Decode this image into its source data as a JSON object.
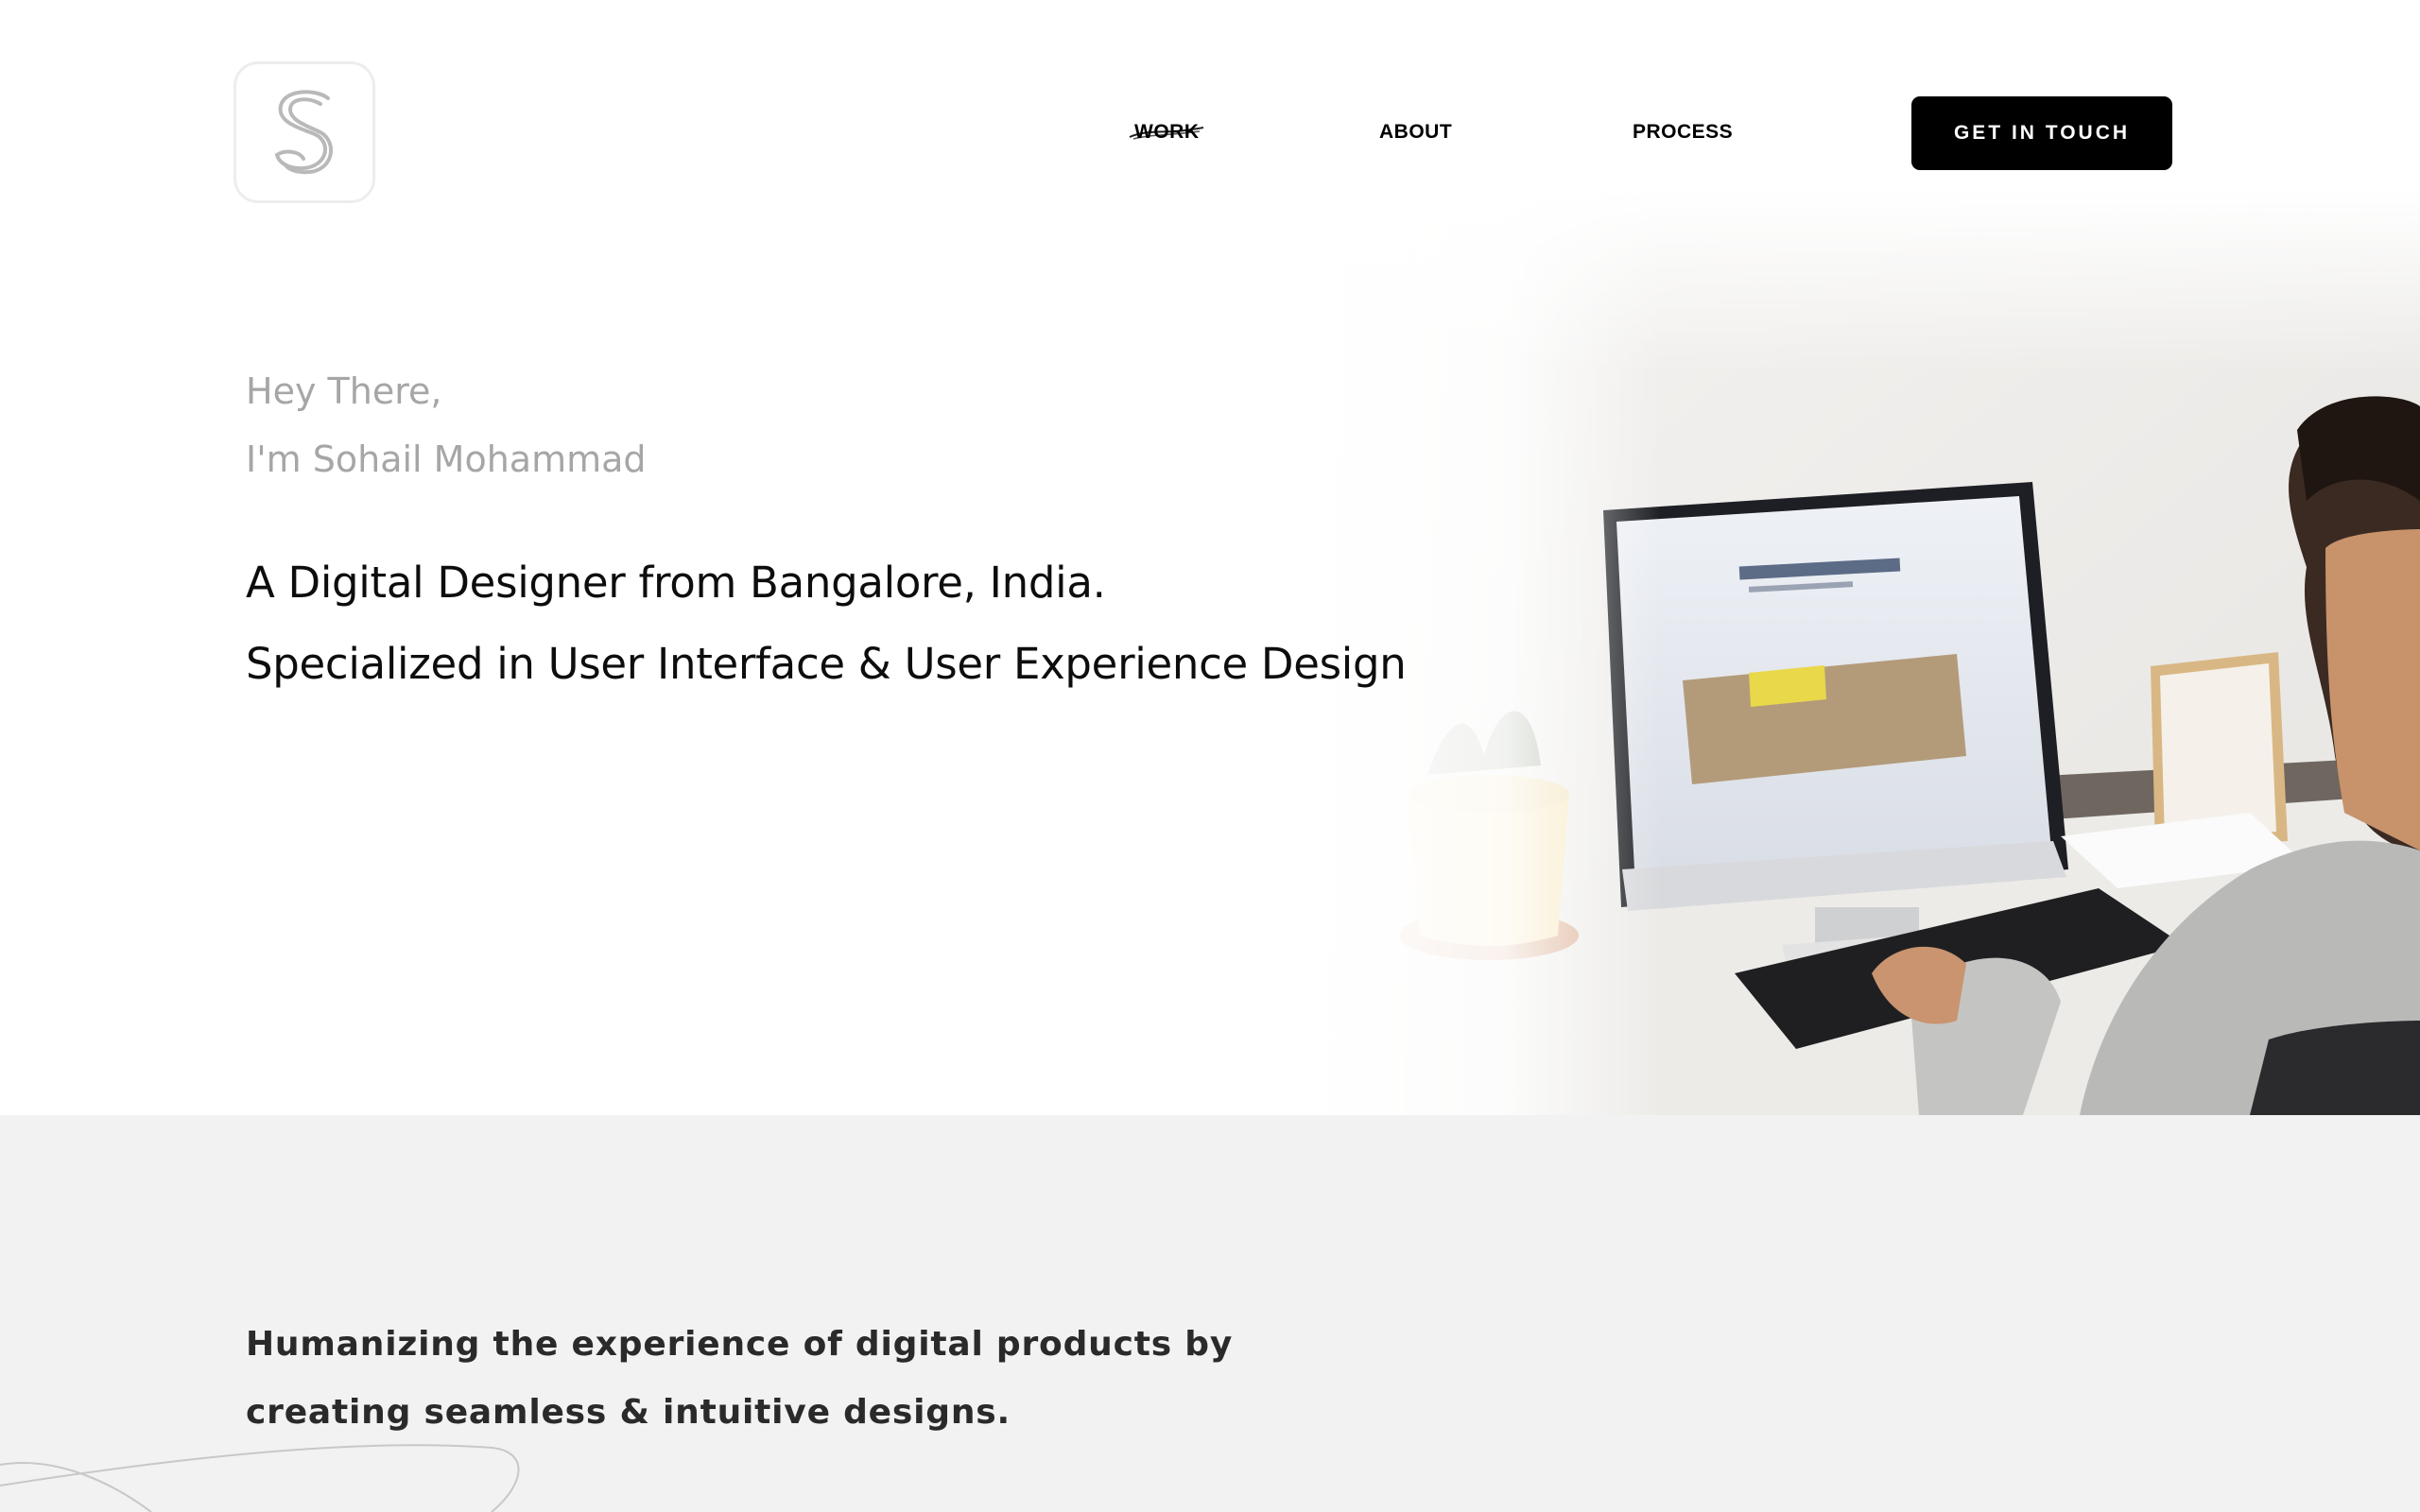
{
  "brand": {
    "logo_letter": "S"
  },
  "nav": {
    "items": [
      {
        "label": "WORK"
      },
      {
        "label": "ABOUT"
      },
      {
        "label": "PROCESS"
      }
    ],
    "cta_label": "GET IN TOUCH"
  },
  "hero": {
    "greeting_1": "Hey There,",
    "greeting_2": "I'm Sohail Mohammad",
    "headline_1": "A Digital Designer from Bangalore, India.",
    "headline_2": "Specialized in User Interface & User Experience Design"
  },
  "about": {
    "tagline_1": "Humanizing the experience of digital products by",
    "tagline_2": "creating seamless & intuitive designs."
  },
  "colors": {
    "cta_background": "#000000",
    "band_background": "#f2f2f2",
    "greeting_text": "#a6a6a6"
  }
}
